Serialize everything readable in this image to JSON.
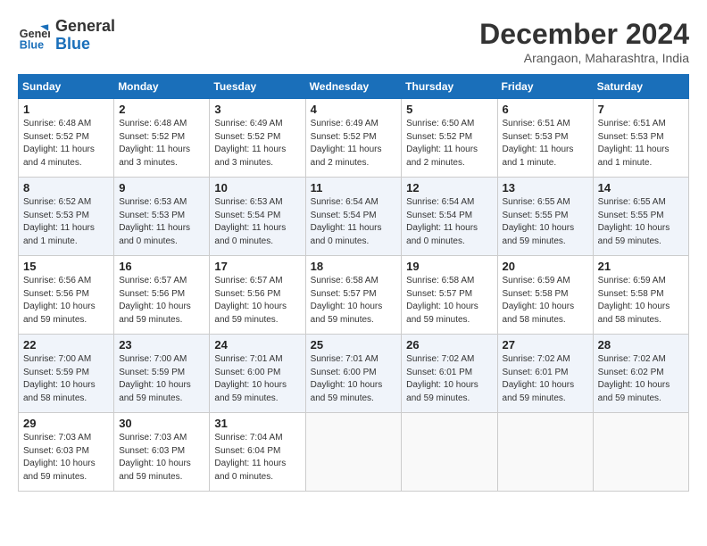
{
  "header": {
    "logo_line1": "General",
    "logo_line2": "Blue",
    "month_year": "December 2024",
    "location": "Arangaon, Maharashtra, India"
  },
  "weekdays": [
    "Sunday",
    "Monday",
    "Tuesday",
    "Wednesday",
    "Thursday",
    "Friday",
    "Saturday"
  ],
  "weeks": [
    [
      {
        "day": "1",
        "info": "Sunrise: 6:48 AM\nSunset: 5:52 PM\nDaylight: 11 hours\nand 4 minutes."
      },
      {
        "day": "2",
        "info": "Sunrise: 6:48 AM\nSunset: 5:52 PM\nDaylight: 11 hours\nand 3 minutes."
      },
      {
        "day": "3",
        "info": "Sunrise: 6:49 AM\nSunset: 5:52 PM\nDaylight: 11 hours\nand 3 minutes."
      },
      {
        "day": "4",
        "info": "Sunrise: 6:49 AM\nSunset: 5:52 PM\nDaylight: 11 hours\nand 2 minutes."
      },
      {
        "day": "5",
        "info": "Sunrise: 6:50 AM\nSunset: 5:52 PM\nDaylight: 11 hours\nand 2 minutes."
      },
      {
        "day": "6",
        "info": "Sunrise: 6:51 AM\nSunset: 5:53 PM\nDaylight: 11 hours\nand 1 minute."
      },
      {
        "day": "7",
        "info": "Sunrise: 6:51 AM\nSunset: 5:53 PM\nDaylight: 11 hours\nand 1 minute."
      }
    ],
    [
      {
        "day": "8",
        "info": "Sunrise: 6:52 AM\nSunset: 5:53 PM\nDaylight: 11 hours\nand 1 minute."
      },
      {
        "day": "9",
        "info": "Sunrise: 6:53 AM\nSunset: 5:53 PM\nDaylight: 11 hours\nand 0 minutes."
      },
      {
        "day": "10",
        "info": "Sunrise: 6:53 AM\nSunset: 5:54 PM\nDaylight: 11 hours\nand 0 minutes."
      },
      {
        "day": "11",
        "info": "Sunrise: 6:54 AM\nSunset: 5:54 PM\nDaylight: 11 hours\nand 0 minutes."
      },
      {
        "day": "12",
        "info": "Sunrise: 6:54 AM\nSunset: 5:54 PM\nDaylight: 11 hours\nand 0 minutes."
      },
      {
        "day": "13",
        "info": "Sunrise: 6:55 AM\nSunset: 5:55 PM\nDaylight: 10 hours\nand 59 minutes."
      },
      {
        "day": "14",
        "info": "Sunrise: 6:55 AM\nSunset: 5:55 PM\nDaylight: 10 hours\nand 59 minutes."
      }
    ],
    [
      {
        "day": "15",
        "info": "Sunrise: 6:56 AM\nSunset: 5:56 PM\nDaylight: 10 hours\nand 59 minutes."
      },
      {
        "day": "16",
        "info": "Sunrise: 6:57 AM\nSunset: 5:56 PM\nDaylight: 10 hours\nand 59 minutes."
      },
      {
        "day": "17",
        "info": "Sunrise: 6:57 AM\nSunset: 5:56 PM\nDaylight: 10 hours\nand 59 minutes."
      },
      {
        "day": "18",
        "info": "Sunrise: 6:58 AM\nSunset: 5:57 PM\nDaylight: 10 hours\nand 59 minutes."
      },
      {
        "day": "19",
        "info": "Sunrise: 6:58 AM\nSunset: 5:57 PM\nDaylight: 10 hours\nand 59 minutes."
      },
      {
        "day": "20",
        "info": "Sunrise: 6:59 AM\nSunset: 5:58 PM\nDaylight: 10 hours\nand 58 minutes."
      },
      {
        "day": "21",
        "info": "Sunrise: 6:59 AM\nSunset: 5:58 PM\nDaylight: 10 hours\nand 58 minutes."
      }
    ],
    [
      {
        "day": "22",
        "info": "Sunrise: 7:00 AM\nSunset: 5:59 PM\nDaylight: 10 hours\nand 58 minutes."
      },
      {
        "day": "23",
        "info": "Sunrise: 7:00 AM\nSunset: 5:59 PM\nDaylight: 10 hours\nand 59 minutes."
      },
      {
        "day": "24",
        "info": "Sunrise: 7:01 AM\nSunset: 6:00 PM\nDaylight: 10 hours\nand 59 minutes."
      },
      {
        "day": "25",
        "info": "Sunrise: 7:01 AM\nSunset: 6:00 PM\nDaylight: 10 hours\nand 59 minutes."
      },
      {
        "day": "26",
        "info": "Sunrise: 7:02 AM\nSunset: 6:01 PM\nDaylight: 10 hours\nand 59 minutes."
      },
      {
        "day": "27",
        "info": "Sunrise: 7:02 AM\nSunset: 6:01 PM\nDaylight: 10 hours\nand 59 minutes."
      },
      {
        "day": "28",
        "info": "Sunrise: 7:02 AM\nSunset: 6:02 PM\nDaylight: 10 hours\nand 59 minutes."
      }
    ],
    [
      {
        "day": "29",
        "info": "Sunrise: 7:03 AM\nSunset: 6:03 PM\nDaylight: 10 hours\nand 59 minutes."
      },
      {
        "day": "30",
        "info": "Sunrise: 7:03 AM\nSunset: 6:03 PM\nDaylight: 10 hours\nand 59 minutes."
      },
      {
        "day": "31",
        "info": "Sunrise: 7:04 AM\nSunset: 6:04 PM\nDaylight: 11 hours\nand 0 minutes."
      },
      null,
      null,
      null,
      null
    ]
  ]
}
